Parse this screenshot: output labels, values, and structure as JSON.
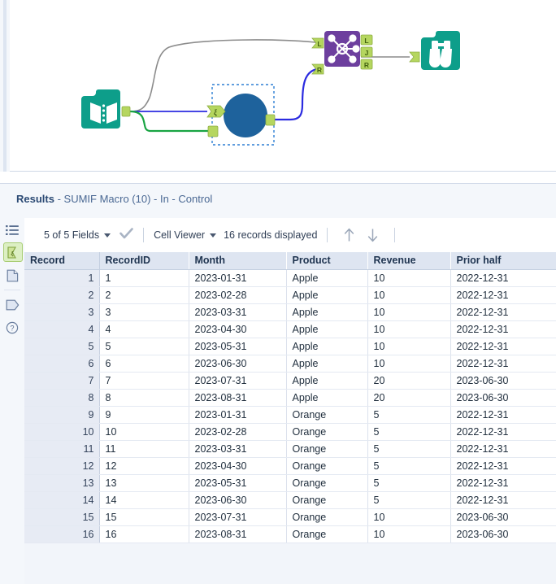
{
  "canvas": {
    "nodes": [
      {
        "name": "text-input-tool",
        "icon": "book-icon",
        "label": ""
      },
      {
        "name": "sumif-macro-tool",
        "icon": "macro-circle-icon",
        "label": "",
        "selected": true
      },
      {
        "name": "join-tool",
        "icon": "join-icon",
        "label": ""
      },
      {
        "name": "browse-tool",
        "icon": "binoculars-icon",
        "label": ""
      }
    ],
    "anchors": {
      "join_left": "L",
      "join_join": "J",
      "join_right": "R",
      "macro_input_question": "ξ"
    },
    "colors": {
      "teal": "#0d9e8a",
      "purple": "#6d3f9e",
      "macro_blue": "#1e629c",
      "anchor_green": "#b5d65f",
      "wire_grey": "#8c8c8c",
      "wire_blue": "#2b2be0",
      "wire_green": "#19a443",
      "selection": "#2d7fd4"
    }
  },
  "results": {
    "title_bold": "Results",
    "title_rest": " - SUMIF Macro (10) - In - Control"
  },
  "rail": {
    "items": [
      {
        "name": "field-list-icon",
        "label": "list-icon"
      },
      {
        "name": "macro-input-icon",
        "label": "macro-input-icon",
        "selected": true
      },
      {
        "name": "data-page-icon",
        "label": "page-icon"
      },
      {
        "name": "anchor-tag-icon",
        "label": "tag-icon"
      },
      {
        "name": "help-icon",
        "label": "question-icon"
      }
    ]
  },
  "toolbar": {
    "fields_label": "5 of 5 Fields",
    "check_icon": "checkmark-icon",
    "viewer_label": "Cell Viewer",
    "records_label": "16 records displayed",
    "up_icon": "arrow-up-icon",
    "down_icon": "arrow-down-icon"
  },
  "table": {
    "columns": [
      "Record",
      "RecordID",
      "Month",
      "Product",
      "Revenue",
      "Prior half"
    ],
    "rows": [
      [
        "1",
        "1",
        "2023-01-31",
        "Apple",
        "10",
        "2022-12-31"
      ],
      [
        "2",
        "2",
        "2023-02-28",
        "Apple",
        "10",
        "2022-12-31"
      ],
      [
        "3",
        "3",
        "2023-03-31",
        "Apple",
        "10",
        "2022-12-31"
      ],
      [
        "4",
        "4",
        "2023-04-30",
        "Apple",
        "10",
        "2022-12-31"
      ],
      [
        "5",
        "5",
        "2023-05-31",
        "Apple",
        "10",
        "2022-12-31"
      ],
      [
        "6",
        "6",
        "2023-06-30",
        "Apple",
        "10",
        "2022-12-31"
      ],
      [
        "7",
        "7",
        "2023-07-31",
        "Apple",
        "20",
        "2023-06-30"
      ],
      [
        "8",
        "8",
        "2023-08-31",
        "Apple",
        "20",
        "2023-06-30"
      ],
      [
        "9",
        "9",
        "2023-01-31",
        "Orange",
        "5",
        "2022-12-31"
      ],
      [
        "10",
        "10",
        "2023-02-28",
        "Orange",
        "5",
        "2022-12-31"
      ],
      [
        "11",
        "11",
        "2023-03-31",
        "Orange",
        "5",
        "2022-12-31"
      ],
      [
        "12",
        "12",
        "2023-04-30",
        "Orange",
        "5",
        "2022-12-31"
      ],
      [
        "13",
        "13",
        "2023-05-31",
        "Orange",
        "5",
        "2022-12-31"
      ],
      [
        "14",
        "14",
        "2023-06-30",
        "Orange",
        "5",
        "2022-12-31"
      ],
      [
        "15",
        "15",
        "2023-07-31",
        "Orange",
        "10",
        "2023-06-30"
      ],
      [
        "16",
        "16",
        "2023-08-31",
        "Orange",
        "10",
        "2023-06-30"
      ]
    ]
  }
}
